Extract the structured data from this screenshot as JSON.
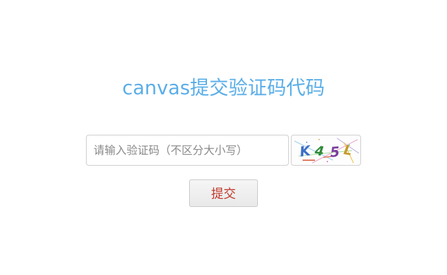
{
  "header": {
    "title": "canvas提交验证码代码"
  },
  "form": {
    "input_placeholder": "请输入验证码（不区分大小写）",
    "input_value": "",
    "captcha": {
      "chars": [
        "K",
        "4",
        "5",
        "L"
      ],
      "char_colors": [
        "#3b6fc6",
        "#2f8a3b",
        "#7a3fa0",
        "#c49a2a"
      ]
    },
    "submit_label": "提交"
  }
}
